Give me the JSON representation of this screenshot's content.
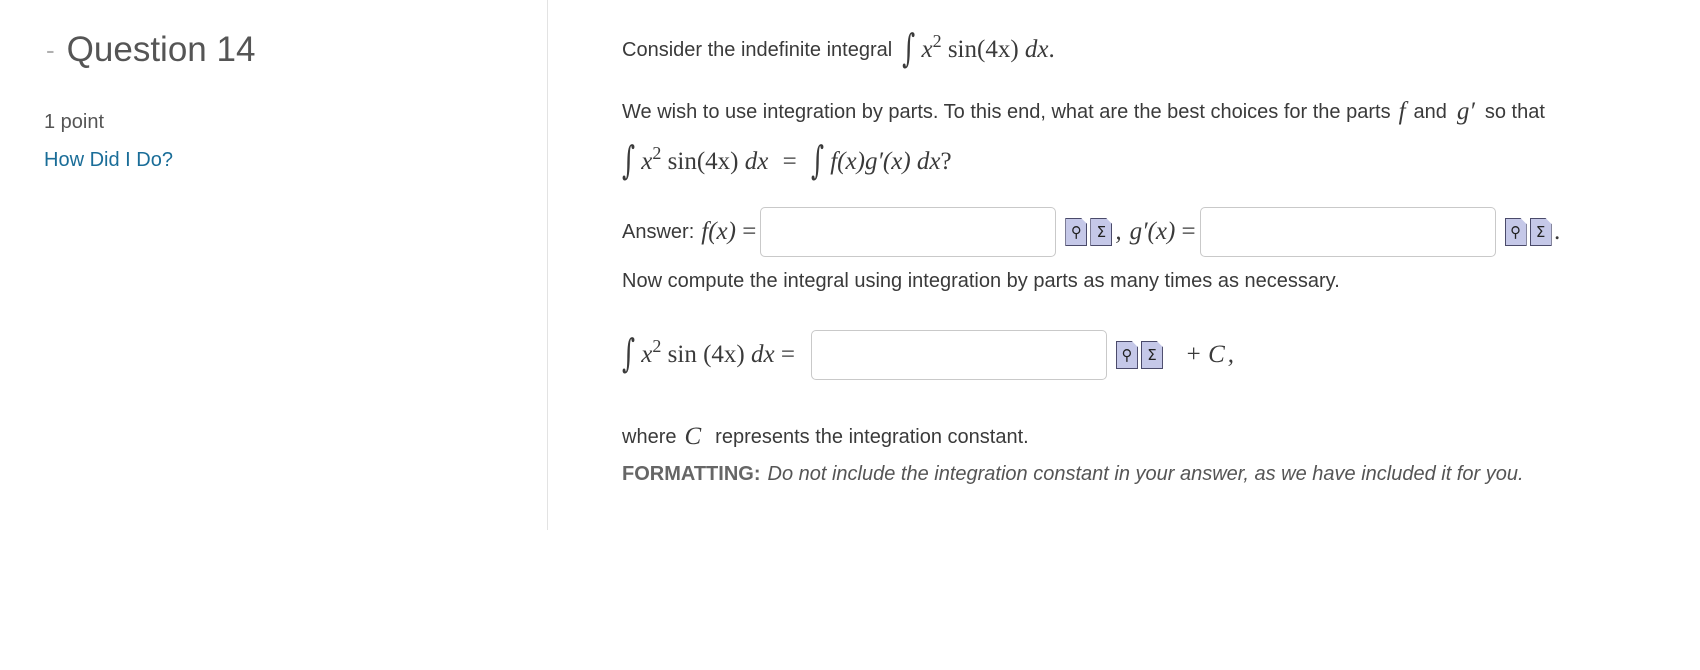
{
  "sidebar": {
    "collapse_symbol": "-",
    "question_title": "Question 14",
    "points": "1 point",
    "how_did_i_do": "How Did I Do?"
  },
  "question": {
    "intro_text": "Consider the indefinite integral",
    "parts_text_1": "We wish to use integration by parts.  To this end, what are the best choices for the parts",
    "parts_and": "and",
    "parts_so_that": "so that",
    "answer_label": "Answer:",
    "compute_text": "Now compute the integral using integration by parts as many times as necessary.",
    "where_text": "where",
    "constant_text": "represents the integration constant.",
    "formatting_label": "FORMATTING:",
    "formatting_text": "Do not include the integration constant in your answer, as we have included it for you."
  },
  "math": {
    "integral_sign": "∫",
    "x": "x",
    "exp": "2",
    "sin": "sin",
    "arg": "(4x)",
    "dx": "dx",
    "f": "f",
    "g_prime": "g′",
    "f_of_x": "f(x)",
    "g_prime_of_x": "g′(x)",
    "eq": "=",
    "plus_c": "+ C",
    "C": "C"
  },
  "inputs": {
    "f_value": "",
    "g_value": "",
    "integral_value": ""
  },
  "icons": {
    "preview": "preview-icon",
    "equation_editor": "equation-editor-icon"
  }
}
